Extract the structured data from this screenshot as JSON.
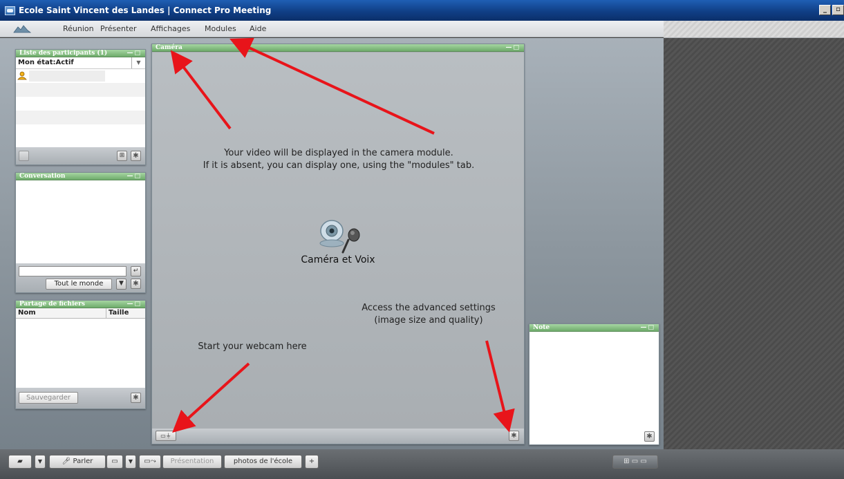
{
  "window": {
    "title": "Ecole Saint Vincent des Landes | Connect Pro Meeting",
    "minimize": "_",
    "maximize": "▫"
  },
  "menubar": {
    "items": [
      "Réunion",
      "Présenter",
      "Affichages",
      "Modules",
      "Aide"
    ]
  },
  "participants_pod": {
    "title": "Liste des participants (1)",
    "controls": "—□",
    "status": "Mon état:Actif"
  },
  "conversation_pod": {
    "title": "Conversation",
    "controls": "—□",
    "send_icon": "↵",
    "recipient": "Tout le monde"
  },
  "files_pod": {
    "title": "Partage de fichiers",
    "controls": "—□",
    "columns": [
      "Nom",
      "Taille"
    ],
    "save_button": "Sauvegarder"
  },
  "camera_pod": {
    "title": "Caméra",
    "controls": "—□",
    "caption": "Caméra et Voix"
  },
  "note_pod": {
    "title": "Note",
    "controls": "—□"
  },
  "annotations": {
    "video_line1": "Your video will be displayed in the camera module.",
    "video_line2": "If it is absent, you can display one, using the \"modules\" tab.",
    "settings_line1": "Access the advanced settings",
    "settings_line2": "(image size and quality)",
    "webcam": "Start your webcam here"
  },
  "bottombar": {
    "talk_button": "Parler",
    "tab_presentation": "Présentation",
    "tab_photos": "photos de l'école",
    "add_tab": "+"
  },
  "colors": {
    "pod_header": "#6eab6b",
    "title_bar": "#103f86",
    "annotation_arrow": "#e8141a"
  }
}
